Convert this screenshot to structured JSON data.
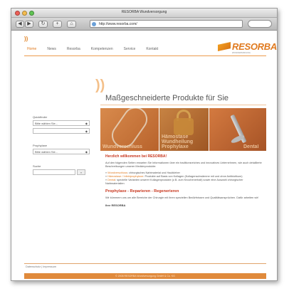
{
  "window": {
    "title": "RESORBA Wundversorgung",
    "url": "http://www.resorba.com/",
    "lights": [
      "#ee5f57",
      "#f5bd4f",
      "#61c454"
    ]
  },
  "toolbar": {
    "back": "◀",
    "forward": "▶",
    "reload": "↻",
    "add": "+",
    "home": "⌂"
  },
  "site": {
    "mini_logo": "))",
    "nav": [
      "Home",
      "News",
      "Resorba",
      "Kompetenzen",
      "Service",
      "Kontakt"
    ],
    "logo_text": "RESORBA",
    "logo_sub": "WUNDVERSORGUNG",
    "accent_color": "#e07a1f",
    "hero_swoosh": "))",
    "headline": "Maßgeschneiderte Produkte für Sie",
    "sidebar": {
      "quickfinder_label": "Quickfinder",
      "quickfinder_select1": "Bitte wählen Sie...",
      "quickfinder_select2": "",
      "prophylaxe_label": "Prophylaxe",
      "prophylaxe_select": "Bitte wählen Sie...",
      "suche_label": "Suche",
      "search_button": "»"
    },
    "tiles": [
      {
        "label": "Wundverschluss"
      },
      {
        "label": "Hämostase Wundheilung Prophylaxe"
      },
      {
        "label": "Dental"
      }
    ],
    "content": {
      "welcome": "Herzlich willkommen bei RESORBA!",
      "intro": "Auf den folgenden Seiten erwarten Sie Informationen über ein traditionsreiches und innovatives Unternehmen, wie auch detaillierte Beschreibungen unserer Medizinprodukte:",
      "list": [
        {
          "hl": "Wundverschluss",
          "text": ": chirurgisches Nahtmaterial und Hautkleber"
        },
        {
          "hl": "Hämostase / Infektprophylaxe",
          "text": ": Produkte auf Basis von Kollagen (Kollagenschwämme mit und ohne Antibiotikum)"
        },
        {
          "hl": "Dental",
          "text": ": spezielle Varianten unserer Kollagenprodukte (z.B. zum Knochenerhalt) sowie eine Auswahl chirurgischer Nahtmaterialien"
        }
      ],
      "subheadline": "Prophylaxe - Reparieren - Regenerieren",
      "body2": "Wir kümmern uns um alle Bereiche der Chirurgie mit ihren speziellen Bedürfnissen und Qualitätsansprüchen. Dafür arbeiten wir!",
      "sign": "Ihre RESORBA"
    },
    "footer": {
      "links": "Datenschutz  |  Impressum",
      "copyright": "© 2008 RESORBA Wundversorgung GmbH & Co. KG"
    }
  }
}
